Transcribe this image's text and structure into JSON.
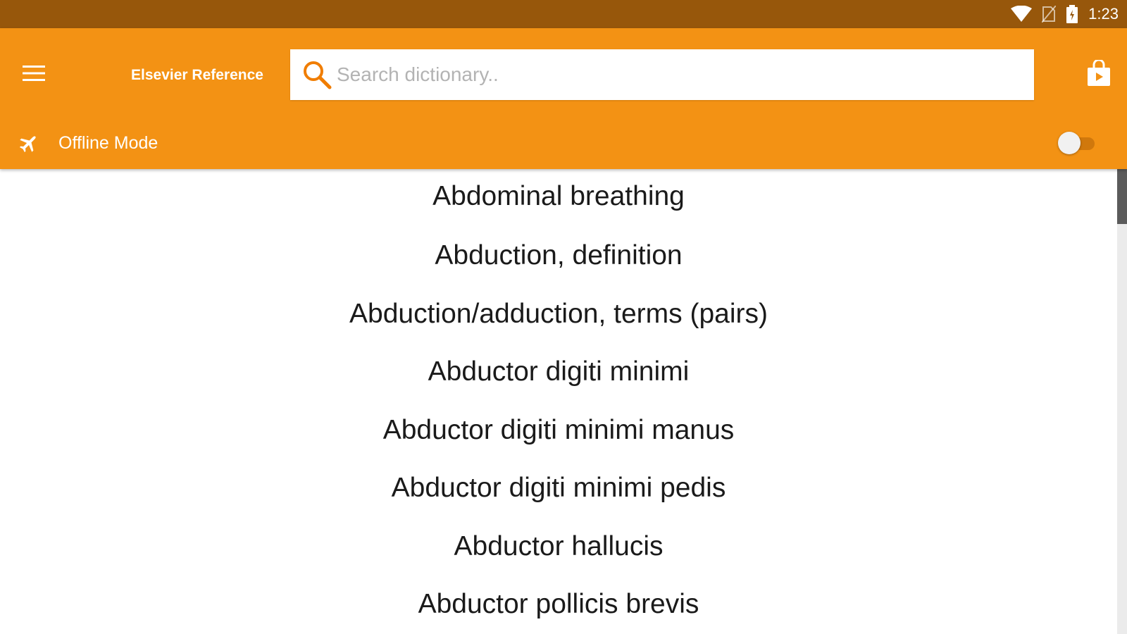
{
  "status_bar": {
    "time": "1:23",
    "icons": [
      "wifi-icon",
      "no-sim-icon",
      "battery-icon"
    ]
  },
  "app_bar": {
    "menu_icon": "hamburger-menu-icon",
    "title": "Elsevier Reference",
    "search": {
      "placeholder": "Search dictionary..",
      "value": ""
    },
    "store_icon": "shopping-bag-icon"
  },
  "offline_mode": {
    "icon": "airplane-icon",
    "label": "Offline Mode",
    "enabled": false
  },
  "terms": [
    "Abdominal breathing",
    "Abduction, definition",
    "Abduction/adduction, terms (pairs)",
    "Abductor digiti minimi",
    "Abductor digiti minimi manus",
    "Abductor digiti minimi pedis",
    "Abductor hallucis",
    "Abductor pollicis brevis"
  ],
  "colors": {
    "status_bar": "#97570b",
    "app_bar": "#f39214",
    "accent": "#f07d00",
    "text": "#1a1a1a"
  }
}
